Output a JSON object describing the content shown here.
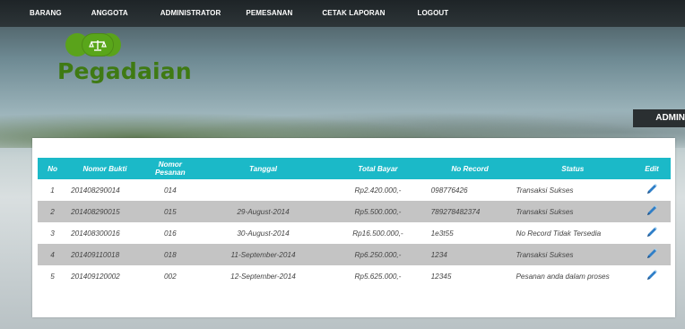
{
  "nav": {
    "items": [
      "BARANG",
      "ANGGOTA",
      "ADMINISTRATOR",
      "PEMESANAN",
      "CETAK LAPORAN",
      "LOGOUT"
    ]
  },
  "logo": {
    "text": "Pegadaian",
    "icon": "scales-icon",
    "brand_color": "#5aa31b"
  },
  "admin_badge": "ADMIN",
  "table": {
    "header_color": "#1bb9c8",
    "headers": [
      "No",
      "Nomor Bukti",
      "Nomor Pesanan",
      "Tanggal",
      "Total Bayar",
      "No Record",
      "Status",
      "Edit"
    ],
    "rows": [
      {
        "no": "1",
        "bukti": "201408290014",
        "pesanan": "014",
        "tanggal": "",
        "total": "Rp2.420.000,-",
        "record": "098776426",
        "status": "Transaksi Sukses",
        "edit_icon": "pencil-icon"
      },
      {
        "no": "2",
        "bukti": "201408290015",
        "pesanan": "015",
        "tanggal": "29-August-2014",
        "total": "Rp5.500.000,-",
        "record": "789278482374",
        "status": "Transaksi Sukses",
        "edit_icon": "pencil-icon"
      },
      {
        "no": "3",
        "bukti": "201408300016",
        "pesanan": "016",
        "tanggal": "30-August-2014",
        "total": "Rp16.500.000,-",
        "record": "1e3t55",
        "status": "No Record Tidak Tersedia",
        "edit_icon": "pencil-icon"
      },
      {
        "no": "4",
        "bukti": "201409110018",
        "pesanan": "018",
        "tanggal": "11-September-2014",
        "total": "Rp6.250.000,-",
        "record": "1234",
        "status": "Transaksi Sukses",
        "edit_icon": "pencil-icon"
      },
      {
        "no": "5",
        "bukti": "201409120002",
        "pesanan": "002",
        "tanggal": "12-September-2014",
        "total": "Rp5.625.000,-",
        "record": "12345",
        "status": "Pesanan anda dalam proses",
        "edit_icon": "pencil-icon"
      }
    ]
  }
}
